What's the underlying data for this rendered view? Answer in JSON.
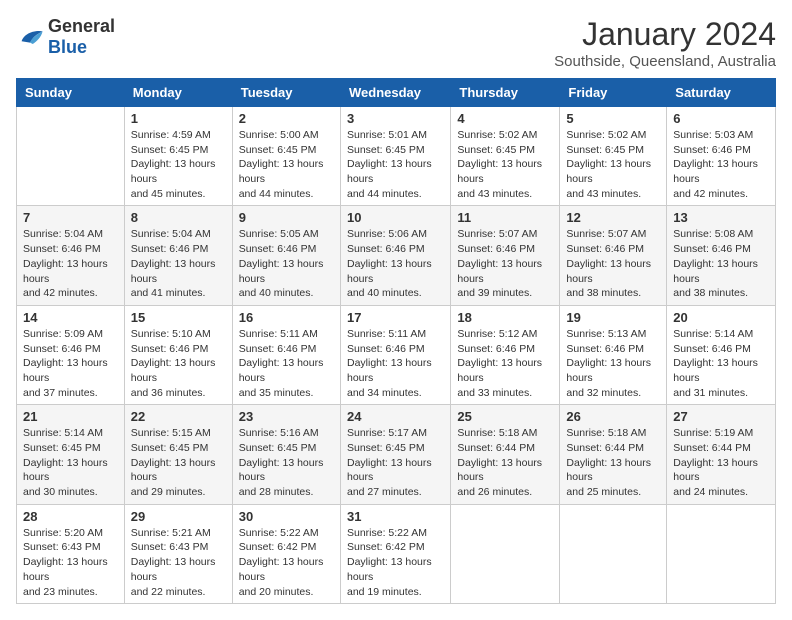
{
  "logo": {
    "general": "General",
    "blue": "Blue"
  },
  "title": "January 2024",
  "subtitle": "Southside, Queensland, Australia",
  "days": [
    "Sunday",
    "Monday",
    "Tuesday",
    "Wednesday",
    "Thursday",
    "Friday",
    "Saturday"
  ],
  "weeks": [
    [
      {
        "day": "",
        "sunrise": "",
        "sunset": "",
        "daylight": ""
      },
      {
        "day": "1",
        "sunrise": "Sunrise: 4:59 AM",
        "sunset": "Sunset: 6:45 PM",
        "daylight": "Daylight: 13 hours and 45 minutes."
      },
      {
        "day": "2",
        "sunrise": "Sunrise: 5:00 AM",
        "sunset": "Sunset: 6:45 PM",
        "daylight": "Daylight: 13 hours and 44 minutes."
      },
      {
        "day": "3",
        "sunrise": "Sunrise: 5:01 AM",
        "sunset": "Sunset: 6:45 PM",
        "daylight": "Daylight: 13 hours and 44 minutes."
      },
      {
        "day": "4",
        "sunrise": "Sunrise: 5:02 AM",
        "sunset": "Sunset: 6:45 PM",
        "daylight": "Daylight: 13 hours and 43 minutes."
      },
      {
        "day": "5",
        "sunrise": "Sunrise: 5:02 AM",
        "sunset": "Sunset: 6:45 PM",
        "daylight": "Daylight: 13 hours and 43 minutes."
      },
      {
        "day": "6",
        "sunrise": "Sunrise: 5:03 AM",
        "sunset": "Sunset: 6:46 PM",
        "daylight": "Daylight: 13 hours and 42 minutes."
      }
    ],
    [
      {
        "day": "7",
        "sunrise": "Sunrise: 5:04 AM",
        "sunset": "Sunset: 6:46 PM",
        "daylight": "Daylight: 13 hours and 42 minutes."
      },
      {
        "day": "8",
        "sunrise": "Sunrise: 5:04 AM",
        "sunset": "Sunset: 6:46 PM",
        "daylight": "Daylight: 13 hours and 41 minutes."
      },
      {
        "day": "9",
        "sunrise": "Sunrise: 5:05 AM",
        "sunset": "Sunset: 6:46 PM",
        "daylight": "Daylight: 13 hours and 40 minutes."
      },
      {
        "day": "10",
        "sunrise": "Sunrise: 5:06 AM",
        "sunset": "Sunset: 6:46 PM",
        "daylight": "Daylight: 13 hours and 40 minutes."
      },
      {
        "day": "11",
        "sunrise": "Sunrise: 5:07 AM",
        "sunset": "Sunset: 6:46 PM",
        "daylight": "Daylight: 13 hours and 39 minutes."
      },
      {
        "day": "12",
        "sunrise": "Sunrise: 5:07 AM",
        "sunset": "Sunset: 6:46 PM",
        "daylight": "Daylight: 13 hours and 38 minutes."
      },
      {
        "day": "13",
        "sunrise": "Sunrise: 5:08 AM",
        "sunset": "Sunset: 6:46 PM",
        "daylight": "Daylight: 13 hours and 38 minutes."
      }
    ],
    [
      {
        "day": "14",
        "sunrise": "Sunrise: 5:09 AM",
        "sunset": "Sunset: 6:46 PM",
        "daylight": "Daylight: 13 hours and 37 minutes."
      },
      {
        "day": "15",
        "sunrise": "Sunrise: 5:10 AM",
        "sunset": "Sunset: 6:46 PM",
        "daylight": "Daylight: 13 hours and 36 minutes."
      },
      {
        "day": "16",
        "sunrise": "Sunrise: 5:11 AM",
        "sunset": "Sunset: 6:46 PM",
        "daylight": "Daylight: 13 hours and 35 minutes."
      },
      {
        "day": "17",
        "sunrise": "Sunrise: 5:11 AM",
        "sunset": "Sunset: 6:46 PM",
        "daylight": "Daylight: 13 hours and 34 minutes."
      },
      {
        "day": "18",
        "sunrise": "Sunrise: 5:12 AM",
        "sunset": "Sunset: 6:46 PM",
        "daylight": "Daylight: 13 hours and 33 minutes."
      },
      {
        "day": "19",
        "sunrise": "Sunrise: 5:13 AM",
        "sunset": "Sunset: 6:46 PM",
        "daylight": "Daylight: 13 hours and 32 minutes."
      },
      {
        "day": "20",
        "sunrise": "Sunrise: 5:14 AM",
        "sunset": "Sunset: 6:46 PM",
        "daylight": "Daylight: 13 hours and 31 minutes."
      }
    ],
    [
      {
        "day": "21",
        "sunrise": "Sunrise: 5:14 AM",
        "sunset": "Sunset: 6:45 PM",
        "daylight": "Daylight: 13 hours and 30 minutes."
      },
      {
        "day": "22",
        "sunrise": "Sunrise: 5:15 AM",
        "sunset": "Sunset: 6:45 PM",
        "daylight": "Daylight: 13 hours and 29 minutes."
      },
      {
        "day": "23",
        "sunrise": "Sunrise: 5:16 AM",
        "sunset": "Sunset: 6:45 PM",
        "daylight": "Daylight: 13 hours and 28 minutes."
      },
      {
        "day": "24",
        "sunrise": "Sunrise: 5:17 AM",
        "sunset": "Sunset: 6:45 PM",
        "daylight": "Daylight: 13 hours and 27 minutes."
      },
      {
        "day": "25",
        "sunrise": "Sunrise: 5:18 AM",
        "sunset": "Sunset: 6:44 PM",
        "daylight": "Daylight: 13 hours and 26 minutes."
      },
      {
        "day": "26",
        "sunrise": "Sunrise: 5:18 AM",
        "sunset": "Sunset: 6:44 PM",
        "daylight": "Daylight: 13 hours and 25 minutes."
      },
      {
        "day": "27",
        "sunrise": "Sunrise: 5:19 AM",
        "sunset": "Sunset: 6:44 PM",
        "daylight": "Daylight: 13 hours and 24 minutes."
      }
    ],
    [
      {
        "day": "28",
        "sunrise": "Sunrise: 5:20 AM",
        "sunset": "Sunset: 6:43 PM",
        "daylight": "Daylight: 13 hours and 23 minutes."
      },
      {
        "day": "29",
        "sunrise": "Sunrise: 5:21 AM",
        "sunset": "Sunset: 6:43 PM",
        "daylight": "Daylight: 13 hours and 22 minutes."
      },
      {
        "day": "30",
        "sunrise": "Sunrise: 5:22 AM",
        "sunset": "Sunset: 6:42 PM",
        "daylight": "Daylight: 13 hours and 20 minutes."
      },
      {
        "day": "31",
        "sunrise": "Sunrise: 5:22 AM",
        "sunset": "Sunset: 6:42 PM",
        "daylight": "Daylight: 13 hours and 19 minutes."
      },
      {
        "day": "",
        "sunrise": "",
        "sunset": "",
        "daylight": ""
      },
      {
        "day": "",
        "sunrise": "",
        "sunset": "",
        "daylight": ""
      },
      {
        "day": "",
        "sunrise": "",
        "sunset": "",
        "daylight": ""
      }
    ]
  ]
}
